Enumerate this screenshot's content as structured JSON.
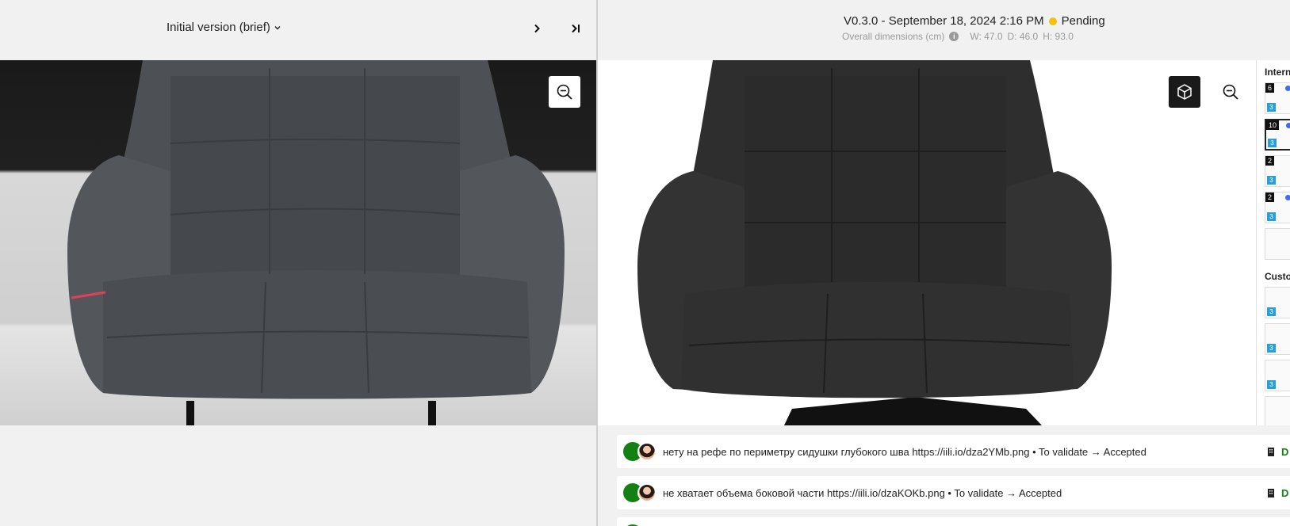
{
  "left_panel": {
    "version_label": "Initial version (brief)",
    "icons": {
      "dropdown": "chevron-down-icon",
      "next": "chevron-right-icon",
      "last": "skip-to-end-icon",
      "zoom": "zoom-out-icon"
    }
  },
  "right_panel": {
    "version_title": "V0.3.0 - September 18, 2024 2:16 PM",
    "status": "Pending",
    "status_color": "#f4c20d",
    "dimensions_label": "Overall dimensions (cm)",
    "width": "W: 47.0",
    "depth": "D: 46.0",
    "height": "H: 93.0",
    "icons": {
      "info": "info-icon",
      "view3d": "cube-icon",
      "zoom": "zoom-out-icon"
    }
  },
  "thumbnails": {
    "internal_title": "Intern",
    "custom_title": "Custo",
    "internal": [
      {
        "count": "6",
        "badge": "3"
      },
      {
        "count": "10",
        "badge": "3"
      },
      {
        "count": "2",
        "badge": "3"
      },
      {
        "count": "2",
        "badge": "3"
      },
      {
        "count": "",
        "badge": ""
      }
    ],
    "custom": [
      {
        "badge": "3"
      },
      {
        "badge": "3"
      },
      {
        "badge": "3"
      },
      {
        "badge": ""
      }
    ]
  },
  "comments": [
    {
      "text": "нету на рефе по периметру сидушки глубокого шва https://iili.io/dza2YMb.png • To validate → Accepted",
      "right_label": "D"
    },
    {
      "text": "не хватает объема боковой части https://iili.io/dzaKOKb.png • To validate → Accepted",
      "right_label": "D"
    }
  ],
  "colors": {
    "accent_green": "#138013",
    "pending_yellow": "#f4c20d",
    "annotation_red": "#e0405a"
  }
}
